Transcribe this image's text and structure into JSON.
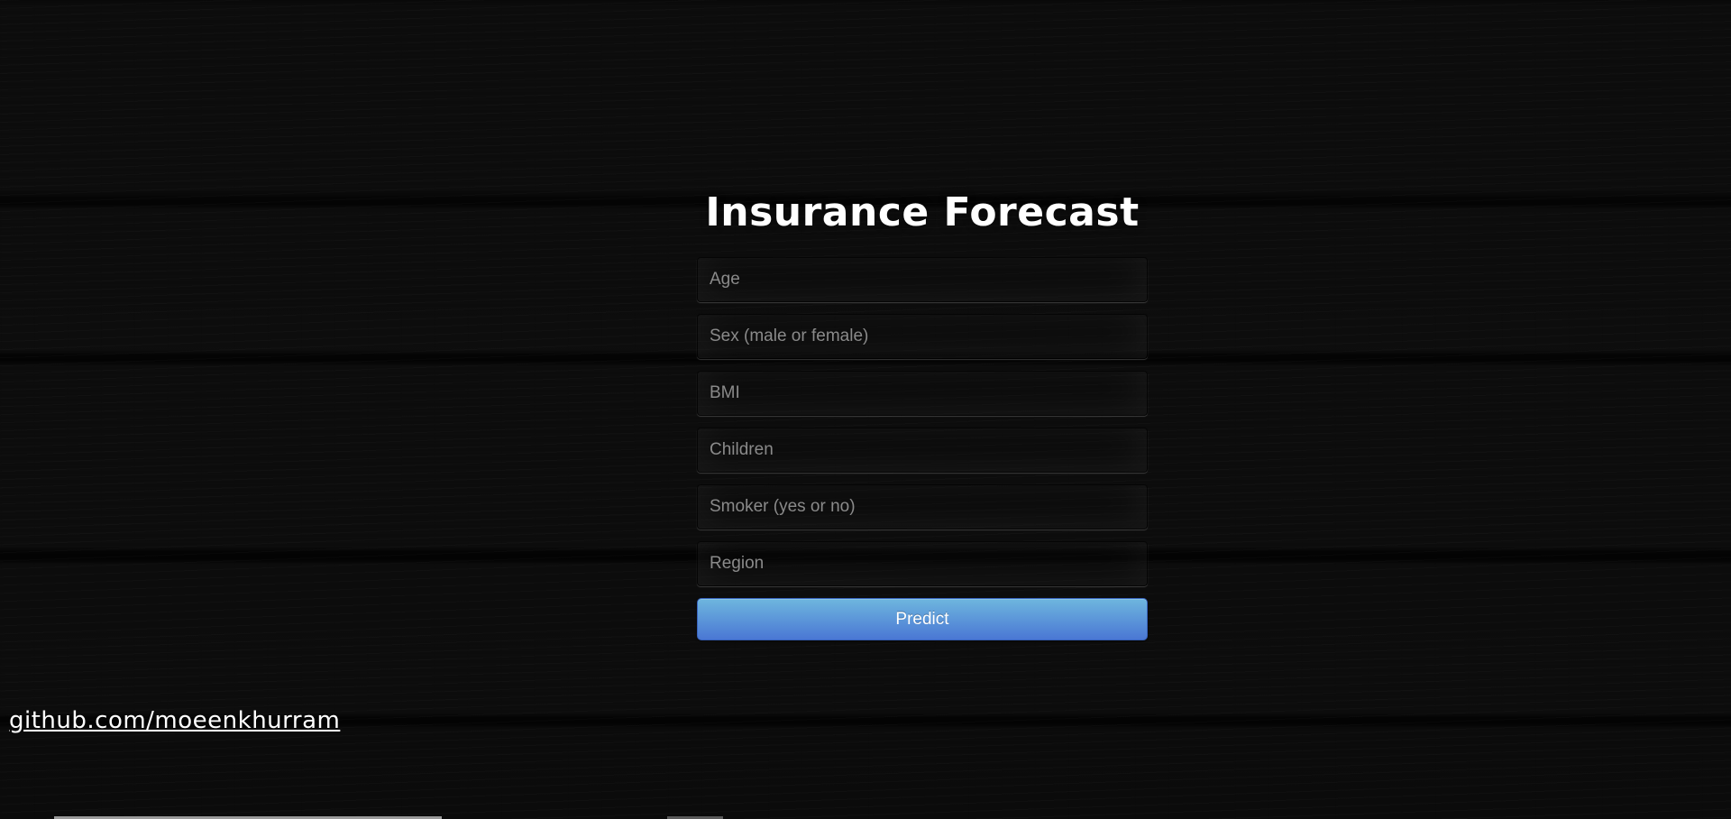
{
  "page": {
    "title": "Insurance Forecast"
  },
  "form": {
    "fields": [
      {
        "name": "age",
        "placeholder": "Age",
        "value": ""
      },
      {
        "name": "sex",
        "placeholder": "Sex (male or female)",
        "value": ""
      },
      {
        "name": "bmi",
        "placeholder": "BMI",
        "value": ""
      },
      {
        "name": "children",
        "placeholder": "Children",
        "value": ""
      },
      {
        "name": "smoker",
        "placeholder": "Smoker (yes or no)",
        "value": ""
      },
      {
        "name": "region",
        "placeholder": "Region",
        "value": ""
      }
    ],
    "submit_label": "Predict"
  },
  "footer": {
    "link_text": "github.com/moeenkhurram"
  },
  "colors": {
    "background": "#262626",
    "button_top": "#6eb6de",
    "button_bottom": "#4a77d4",
    "title_text": "#ffffff"
  }
}
